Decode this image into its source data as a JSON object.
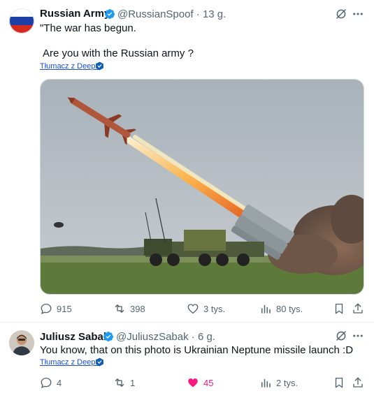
{
  "tweet1": {
    "author_name": "Russian Army",
    "handle_time": "@RussianSpoof · 13 g.",
    "line1": "\"The war has begun.",
    "line2": "Are you with the Russian army ?",
    "translate_label": "Tłumacz z DeepL",
    "stats": {
      "replies": "915",
      "retweets": "398",
      "likes": "3 tys.",
      "views": "80 tys."
    }
  },
  "tweet2": {
    "author_name": "Juliusz Sabak",
    "handle_time": "@JuliuszSabak · 6 g.",
    "text": "You know, that on this photo is Ukrainian Neptune missile launch :D",
    "translate_label": "Tłumacz z DeepL",
    "stats": {
      "replies": "4",
      "retweets": "1",
      "likes": "45",
      "views": "2 tys."
    }
  },
  "colors": {
    "like_active": "#f91880",
    "verified": "#1d9bf0",
    "text_muted": "#536471"
  }
}
